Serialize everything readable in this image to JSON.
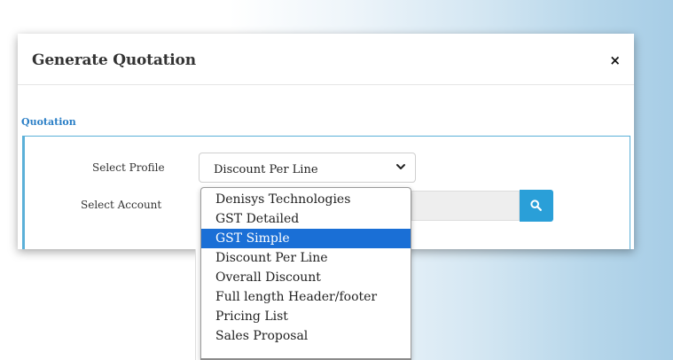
{
  "modal": {
    "title": "Generate Quotation",
    "close_label": "×"
  },
  "section": {
    "label": "Quotation"
  },
  "form": {
    "profile_label": "Select Profile",
    "profile_value": "Discount Per Line",
    "account_label": "Select Account",
    "account_value": ""
  },
  "dropdown": {
    "options": [
      "Denisys Technologies",
      "GST Detailed",
      "GST Simple",
      "Discount Per Line",
      "Overall Discount",
      "Full length Header/footer",
      "Pricing List",
      "Sales Proposal"
    ],
    "highlighted": "GST Simple"
  },
  "icons": {
    "close": "close-icon",
    "chevron": "chevron-down-icon",
    "search": "search-icon"
  },
  "colors": {
    "accent": "#2a9fd8",
    "section_title": "#2b7fc6",
    "highlight": "#1a6fd6"
  }
}
